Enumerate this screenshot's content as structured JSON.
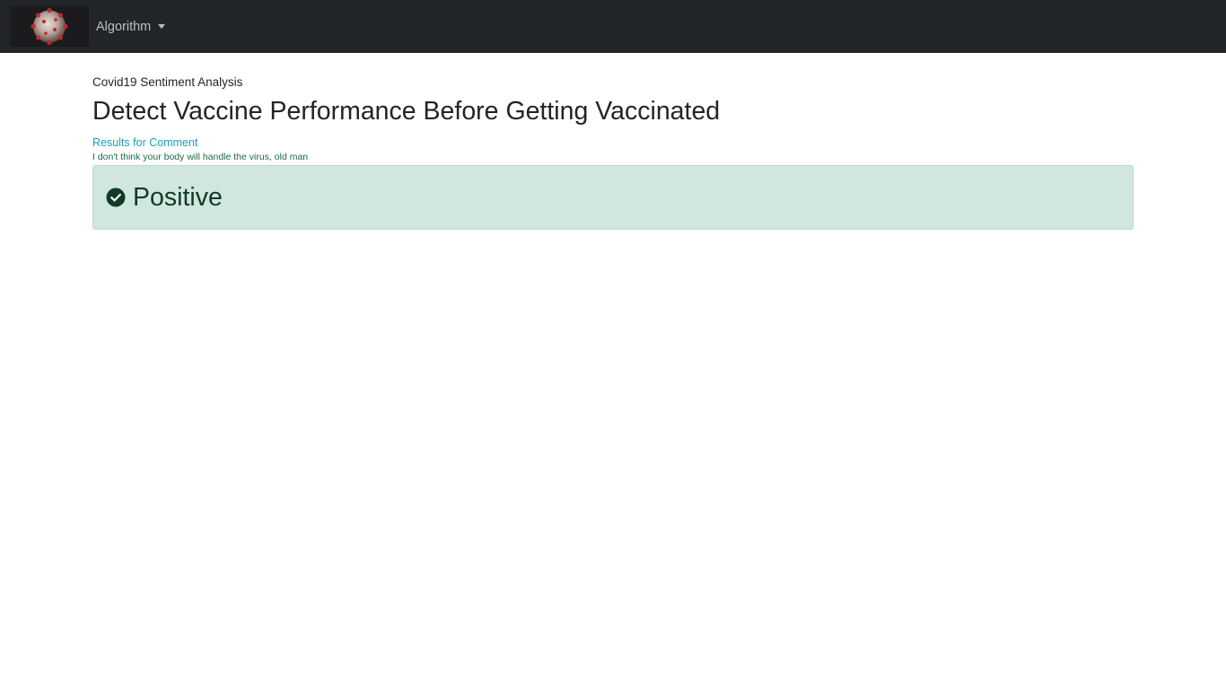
{
  "navbar": {
    "logo_icon": "coronavirus-logo-icon",
    "menu_label": "Algorithm",
    "menu_icon": "caret-down-icon"
  },
  "main": {
    "eyebrow": "Covid19 Sentiment Analysis",
    "title": "Detect Vaccine Performance Before Getting Vaccinated",
    "results_label": "Results for Comment",
    "comment": "I don't think your body will handle the virus, old man",
    "result": {
      "label": "Positive",
      "icon": "check-circle-icon",
      "background": "#d1e7dd",
      "text_color": "#0f3b29"
    }
  },
  "colors": {
    "navbar_bg": "#212429",
    "results_label": "#17a2b8",
    "comment_text": "#1d6b45"
  }
}
